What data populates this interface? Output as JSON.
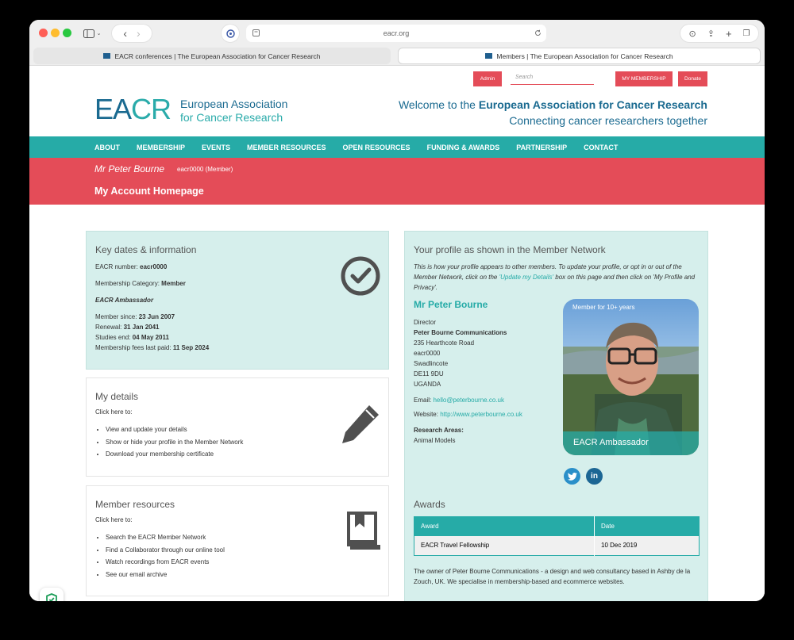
{
  "browser": {
    "url": "eacr.org",
    "tabs": [
      {
        "title": "EACR conferences | The European Association for Cancer Research"
      },
      {
        "title": "Members | The European Association for Cancer Research"
      }
    ]
  },
  "topbar": {
    "admin": "Admin",
    "search_placeholder": "Search",
    "my_membership": "MY MEMBERSHIP",
    "donate": "Donate"
  },
  "header": {
    "logo_ea": "EA",
    "logo_cr": "CR",
    "logo_line1": "European Association",
    "logo_line2": "for Cancer Research",
    "welcome_prefix": "Welcome to the ",
    "welcome_bold": "European Association for Cancer Research",
    "tagline": "Connecting cancer researchers together"
  },
  "nav": [
    "ABOUT",
    "MEMBERSHIP",
    "EVENTS",
    "MEMBER RESOURCES",
    "OPEN RESOURCES",
    "FUNDING & AWARDS",
    "PARTNERSHIP",
    "CONTACT"
  ],
  "account": {
    "name": "Mr Peter Bourne",
    "member_id": "eacr0000 (Member)",
    "heading": "My Account Homepage"
  },
  "key_dates": {
    "title": "Key dates & information",
    "number_label": "EACR number: ",
    "number": "eacr0000",
    "category_label": "Membership Category: ",
    "category": "Member",
    "ambassador": "EACR Ambassador",
    "since_label": "Member since: ",
    "since": "23 Jun 2007",
    "renewal_label": "Renewal: ",
    "renewal": "31 Jan 2041",
    "studies_label": "Studies end: ",
    "studies": "04 May 2011",
    "fees_label": "Membership fees last paid: ",
    "fees": "11 Sep 2024"
  },
  "my_details": {
    "title": "My details",
    "intro": "Click here to:",
    "items": [
      "View and update your details",
      "Show or hide your profile in the Member Network",
      "Download your membership certificate"
    ]
  },
  "member_resources": {
    "title": "Member resources",
    "intro": "Click here to:",
    "items": [
      "Search the EACR Member Network",
      "Find a Collaborator through our online tool",
      "Watch recordings from EACR events",
      "See our email archive"
    ]
  },
  "profile": {
    "title": "Your profile as shown in the Member Network",
    "intro_1": "This is how your profile appears to other members. To update your profile, or opt in or out of the Member Network, click on the ",
    "intro_link": "'Update my Details'",
    "intro_2": " box on this page and then click on 'My Profile and Privacy'.",
    "name": "Mr Peter Bourne",
    "role": "Director",
    "company": "Peter Bourne Communications",
    "address": [
      "235 Hearthcote Road",
      "eacr0000",
      "Swadlincote",
      "DE11 9DU",
      "UGANDA"
    ],
    "email_label": "Email: ",
    "email": "hello@peterbourne.co.uk",
    "website_label": "Website: ",
    "website": "http://www.peterbourne.co.uk",
    "research_label": "Research Areas:",
    "research": "Animal Models",
    "photo_badge": "Member for 10+ years",
    "photo_caption": "EACR Ambassador",
    "twitter": "twitter-icon",
    "linkedin_text": "in"
  },
  "awards": {
    "title": "Awards",
    "headers": [
      "Award",
      "Date"
    ],
    "rows": [
      [
        "EACR Travel Fellowship",
        "10 Dec 2019"
      ]
    ],
    "bio": "The owner of Peter Bourne Communications - a design and web consultancy based in Ashby de la Zouch, UK. We specialise in membership-based and ecommerce websites."
  },
  "colors": {
    "teal": "#26aba7",
    "red": "#e44c58",
    "navy": "#1a6a90",
    "card_teal": "#d6efec"
  }
}
